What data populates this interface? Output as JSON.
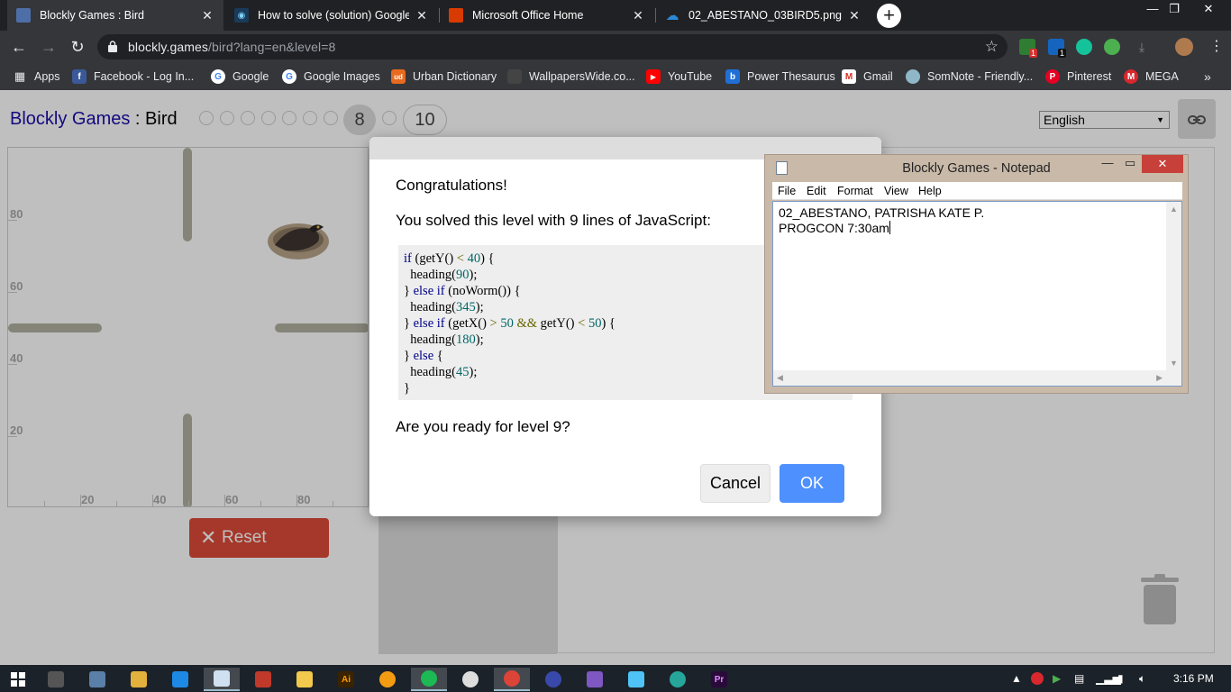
{
  "browser": {
    "tabs": [
      {
        "title": "Blockly Games : Bird",
        "active": true,
        "favicon": "blockly-puzzle-icon"
      },
      {
        "title": "How to solve (solution) Google's",
        "active": false,
        "favicon": "eye-icon"
      },
      {
        "title": "Microsoft Office Home",
        "active": false,
        "favicon": "office-icon"
      },
      {
        "title": "02_ABESTANO_03BIRD5.png - Or",
        "active": false,
        "favicon": "onedrive-icon"
      }
    ],
    "address": {
      "host": "blockly.games",
      "path": "/bird?lang=en&level=8"
    },
    "bookmarks": [
      {
        "label": "Apps",
        "icon": "apps-grid-icon"
      },
      {
        "label": "Facebook - Log In...",
        "icon": "facebook-icon"
      },
      {
        "label": "Google",
        "icon": "google-icon"
      },
      {
        "label": "Google Images",
        "icon": "google-icon"
      },
      {
        "label": "Urban Dictionary",
        "icon": "urban-dictionary-icon"
      },
      {
        "label": "WallpapersWide.co...",
        "icon": "wallpaperswide-icon"
      },
      {
        "label": "YouTube",
        "icon": "youtube-icon"
      },
      {
        "label": "Power Thesaurus",
        "icon": "power-thesaurus-icon"
      },
      {
        "label": "Gmail",
        "icon": "gmail-icon"
      },
      {
        "label": "SomNote - Friendly...",
        "icon": "somnote-icon"
      },
      {
        "label": "Pinterest",
        "icon": "pinterest-icon"
      },
      {
        "label": "MEGA",
        "icon": "mega-icon"
      }
    ],
    "ext_badges": [
      "1",
      "1"
    ]
  },
  "app": {
    "title_link": "Blockly Games",
    "title_sep": " : ",
    "title_game": "Bird",
    "current_level": "8",
    "last_level": "10",
    "language": "English",
    "reset_label": "Reset"
  },
  "maze_axis": {
    "y_labels": [
      "80",
      "60",
      "40",
      "20"
    ],
    "x_labels": [
      "20",
      "40",
      "60",
      "80"
    ]
  },
  "dialog": {
    "congrats": "Congratulations!",
    "solved": "You solved this level with 9 lines of JavaScript:",
    "code_lines": [
      "if (getY() < 40) {",
      "  heading(90);",
      "} else if (noWorm()) {",
      "  heading(345);",
      "} else if (getX() > 50 && getY() < 50) {",
      "  heading(180);",
      "} else {",
      "  heading(45);",
      "}"
    ],
    "ready": "Are you ready for level 9?",
    "cancel_label": "Cancel",
    "ok_label": "OK"
  },
  "notepad": {
    "title": "Blockly Games - Notepad",
    "menu": [
      "File",
      "Edit",
      "Format",
      "View",
      "Help"
    ],
    "line1": "02_ABESTANO, PATRISHA KATE P.",
    "line2": "PROGCON 7:30am"
  },
  "taskbar": {
    "time": "3:16 PM"
  },
  "colors": {
    "reset": "#dd4b39",
    "ok": "#4d90fe",
    "link": "#1a0dab",
    "notepad_close": "#c7403a"
  }
}
